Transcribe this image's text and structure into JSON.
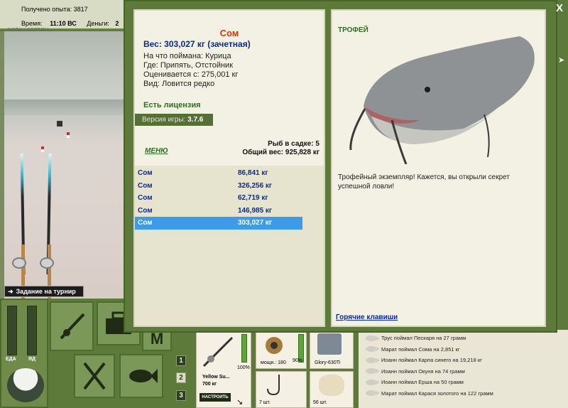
{
  "status": {
    "exp_label": "Получено опыта: 3817",
    "time_label": "Время:",
    "time_value": "11:10 ВС",
    "money_label": "Деньги:",
    "money_value": "2",
    "logo_text": "INSTALLSOFT.RU"
  },
  "scene": {
    "tournament_label": "Задание на турнир"
  },
  "controls": {
    "meter_food": "ЕДА",
    "meter_bite": "ЯД",
    "slots": [
      "1",
      "2",
      "3"
    ]
  },
  "inventory": {
    "rod_name": "Yellow Su...",
    "rod_weight": "700 кг",
    "rod_percent": "100%",
    "tune_button": "НАСТРОИТЬ",
    "reel_power": "мощн.: 180",
    "reel_percent": "90%",
    "line_name": "Glory-630Ti",
    "hooks_count": "7 шт.",
    "bait_count": "56 шт."
  },
  "chat": [
    "Трус поймал Пескаря на 27 грамм",
    "Марат поймал Сома на 2,851 кг",
    "Иоанн поймал Карпа синего на 19,218 кг",
    "Иоанн поймал Окуня на 74 грамм",
    "Иоанн поймал Ерша на 50 грамм",
    "Марат поймал Карася золотого на 122 грамм"
  ],
  "fish_info": {
    "name": "Сом",
    "weight": "Вес: 303,027 кг (зачетная)",
    "caught_on": "На что поймана: Курица",
    "where": "Где: Припять, Отстойник",
    "valued": "Оценивается с: 275,001 кг",
    "species": "Вид: Ловится редко",
    "license": "Есть лицензия",
    "version_label": "Версия игры:",
    "version_value": "3.7.6",
    "menu": "МЕНЮ",
    "fish_in_net": "Рыб в садке: 5",
    "total_weight": "Общий вес: 925,828 кг"
  },
  "catches": [
    {
      "name": "Сом",
      "weight": "86,841 кг"
    },
    {
      "name": "Сом",
      "weight": "326,256 кг"
    },
    {
      "name": "Сом",
      "weight": "62,719 кг"
    },
    {
      "name": "Сом",
      "weight": "146,985 кг"
    },
    {
      "name": "Сом",
      "weight": "303,027 кг"
    }
  ],
  "trophy": {
    "title": "ТРОФЕЙ",
    "text": "Трофейный экземпляр! Кажется, вы открыли секрет успешной ловли!",
    "hotkeys": "Горячие клавиши"
  },
  "close_label": "X"
}
